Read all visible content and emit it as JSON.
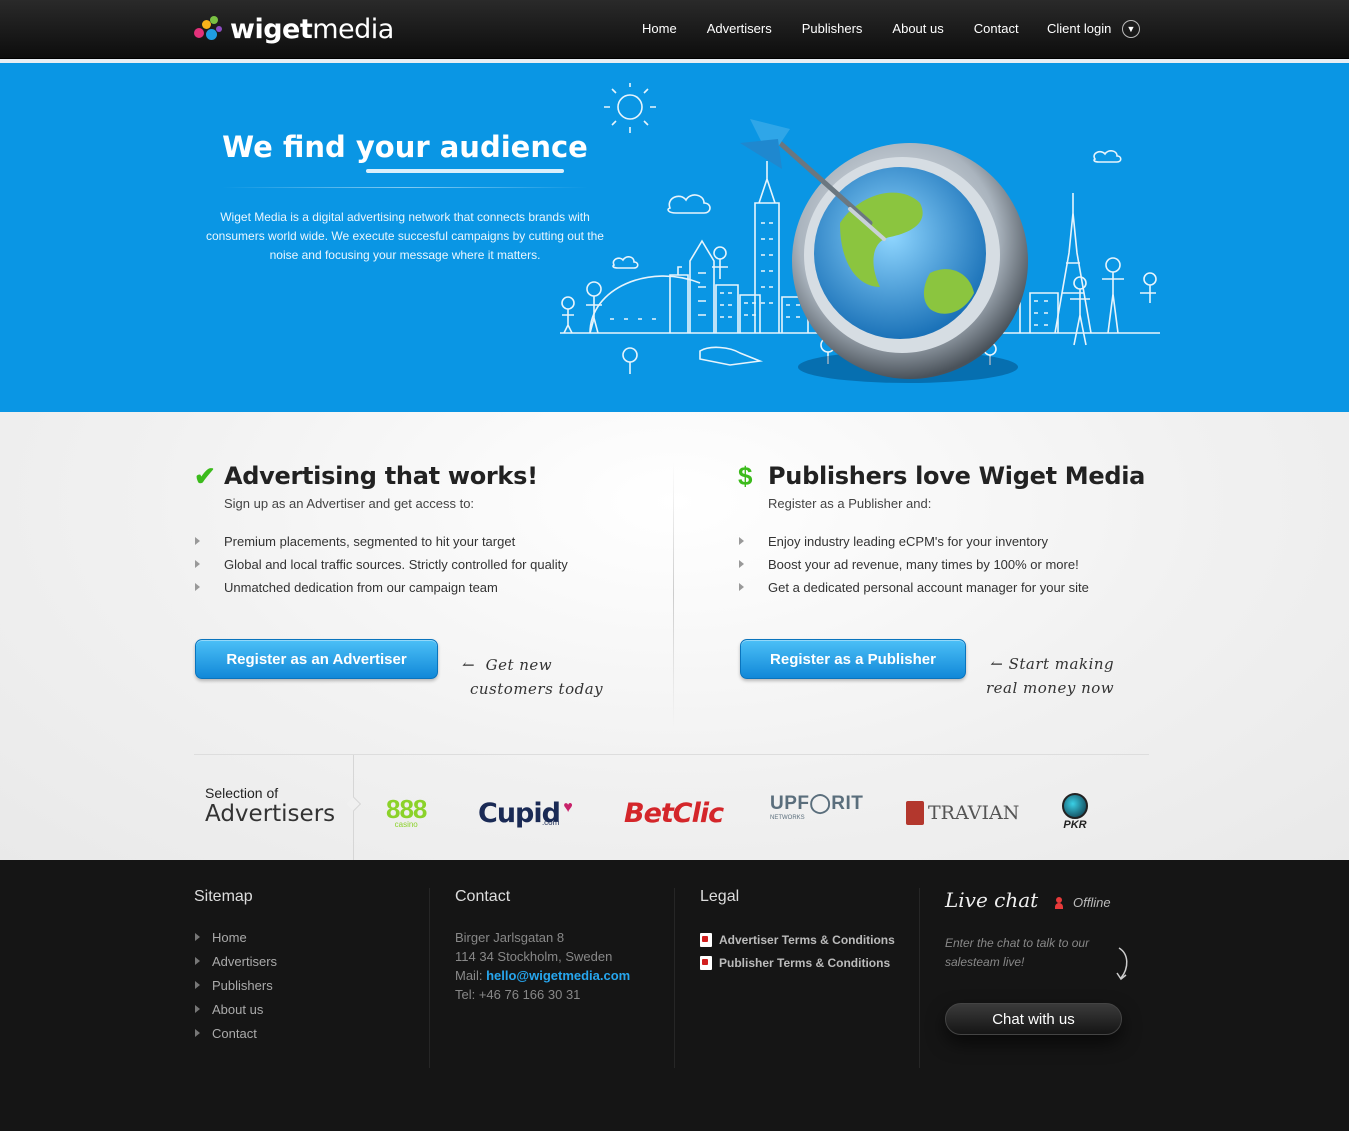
{
  "header": {
    "logo": {
      "bold": "wiget",
      "light": "media"
    },
    "nav": [
      "Home",
      "Advertisers",
      "Publishers",
      "About us",
      "Contact"
    ],
    "client_login": "Client login",
    "login_chevron_icon": "chevron-down-icon"
  },
  "hero": {
    "title": "We find your audience",
    "description": "Wiget Media is a digital advertising network that connects brands with consumers world wide. We execute succesful campaigns by cutting out the noise and focusing your message where it matters."
  },
  "advertisers": {
    "icon": "checkmark-icon",
    "title": "Advertising that works!",
    "subtitle": "Sign up as an Advertiser and get access to:",
    "bullets": [
      "Premium placements, segmented to hit your target",
      "Global and local traffic sources. Strictly controlled for quality",
      "Unmatched dedication from our campaign team"
    ],
    "button": "Register as an Advertiser",
    "note_line1": "Get new",
    "note_line2": "customers today"
  },
  "publishers": {
    "icon": "dollar-icon",
    "title": "Publishers love Wiget Media",
    "subtitle": "Register as a Publisher and:",
    "bullets": [
      "Enjoy industry leading eCPM's for your inventory",
      "Boost your ad revenue, many times by 100% or more!",
      "Get a dedicated personal account manager for your site"
    ],
    "button": "Register as a Publisher",
    "note_line1": "Start making",
    "note_line2": "real money now"
  },
  "selection": {
    "label_small": "Selection of",
    "label_big": "Advertisers",
    "brands": {
      "b888": "888",
      "b888_sub": "casino",
      "cupid": "Cupid",
      "cupid_sub": ".com",
      "betclic": "BetClic",
      "upforit": "UPF◯RIT",
      "upforit_sub": "NETWORKS",
      "travian": "TRAVIAN",
      "pkr": "PKR"
    }
  },
  "footer": {
    "sitemap": {
      "title": "Sitemap",
      "items": [
        "Home",
        "Advertisers",
        "Publishers",
        "About us",
        "Contact"
      ]
    },
    "contact": {
      "title": "Contact",
      "street": "Birger Jarlsgatan 8",
      "city": "114 34 Stockholm, Sweden",
      "mail_label": "Mail:",
      "mail": "hello@wigetmedia.com",
      "tel": "Tel: +46 76 166 30 31"
    },
    "legal": {
      "title": "Legal",
      "items": [
        "Advertiser Terms & Conditions",
        "Publisher Terms & Conditions"
      ]
    },
    "livechat": {
      "title": "Live chat",
      "status": "Offline",
      "description": "Enter the chat to talk to our salesteam live!",
      "button": "Chat with us"
    }
  },
  "colors": {
    "hero_blue": "#0a96e4",
    "button_blue": "#1188d8",
    "check_green": "#3cbb1c",
    "footer_bg": "#151515",
    "mail_link": "#27a6ee"
  }
}
